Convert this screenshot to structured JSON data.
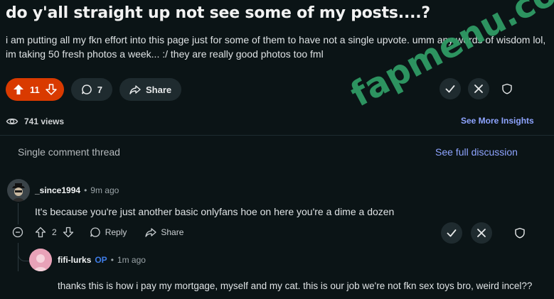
{
  "post": {
    "title": "do y'all straight up not see some of my posts....?",
    "body": "i am putting all my fkn effort into this page just for some of them to have not a single upvote. umm any words of wisdom lol, im taking 50 fresh photos a week... :/ they are really good photos too fml",
    "vote_count": "11",
    "comment_count": "7",
    "share_label": "Share",
    "views": "741 views",
    "insights_label": "See More Insights"
  },
  "thread": {
    "label": "Single comment thread",
    "full_discussion": "See full discussion"
  },
  "comment1": {
    "author": "_since1994",
    "separator": "•",
    "time": "9m ago",
    "text": "It's because you're just another basic onlyfans hoe on here you're a dime a dozen",
    "votes": "2",
    "reply_label": "Reply",
    "share_label": "Share"
  },
  "comment2": {
    "author": "fifi-lurks",
    "op_badge": "OP",
    "separator": "•",
    "time": "1m ago",
    "text": "thanks this is how i pay my mortgage, myself and my cat. this is our job we're not fkn sex toys bro, weird incel??"
  },
  "watermark": "fapmenu.com",
  "colors": {
    "background": "#0b1416",
    "upvote_active": "#d93a00",
    "link": "#8ea4ff",
    "op": "#3f7de8"
  }
}
